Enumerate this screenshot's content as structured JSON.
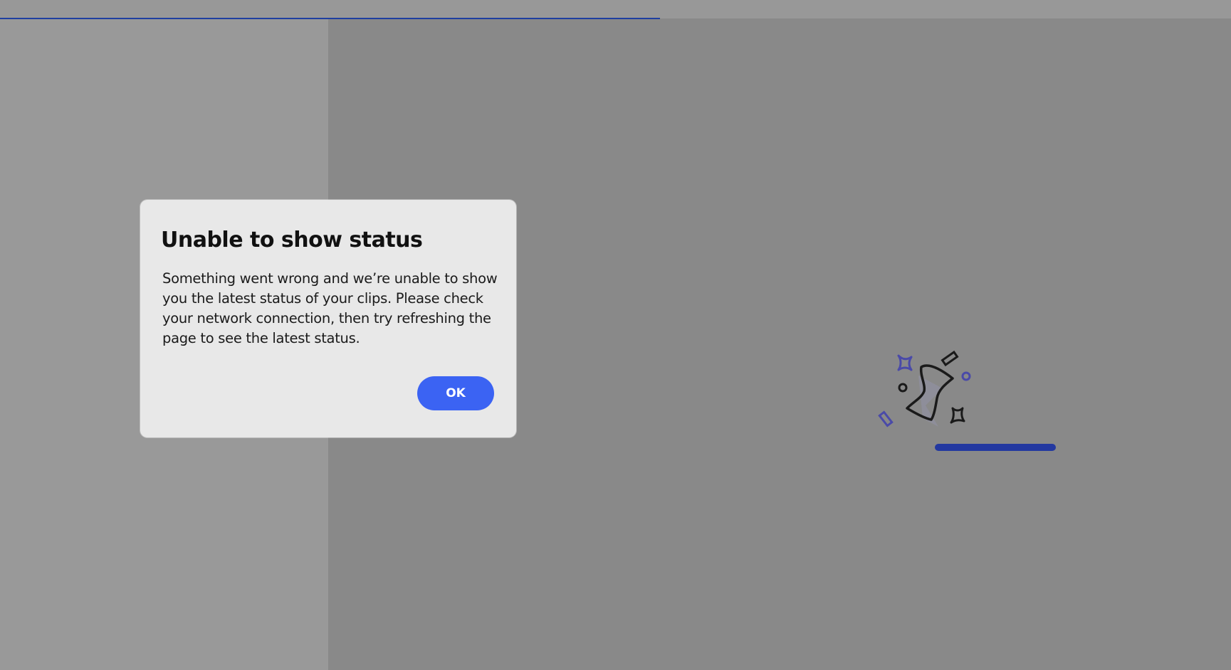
{
  "colors": {
    "accent": "#3b63f3",
    "progress": "#1f3fa0",
    "overlay": "#898989"
  },
  "page_loading": {
    "progress_fraction": 0.536
  },
  "illustration": {
    "icon": "hourglass-sparkles-icon",
    "progress_fraction": 1.0
  },
  "dialog": {
    "title": "Unable to show status",
    "body": "Something went wrong and we’re unable to show you the latest status of your clips. Please check your network connection, then try refreshing the page to see the latest status.",
    "ok_label": "OK"
  }
}
